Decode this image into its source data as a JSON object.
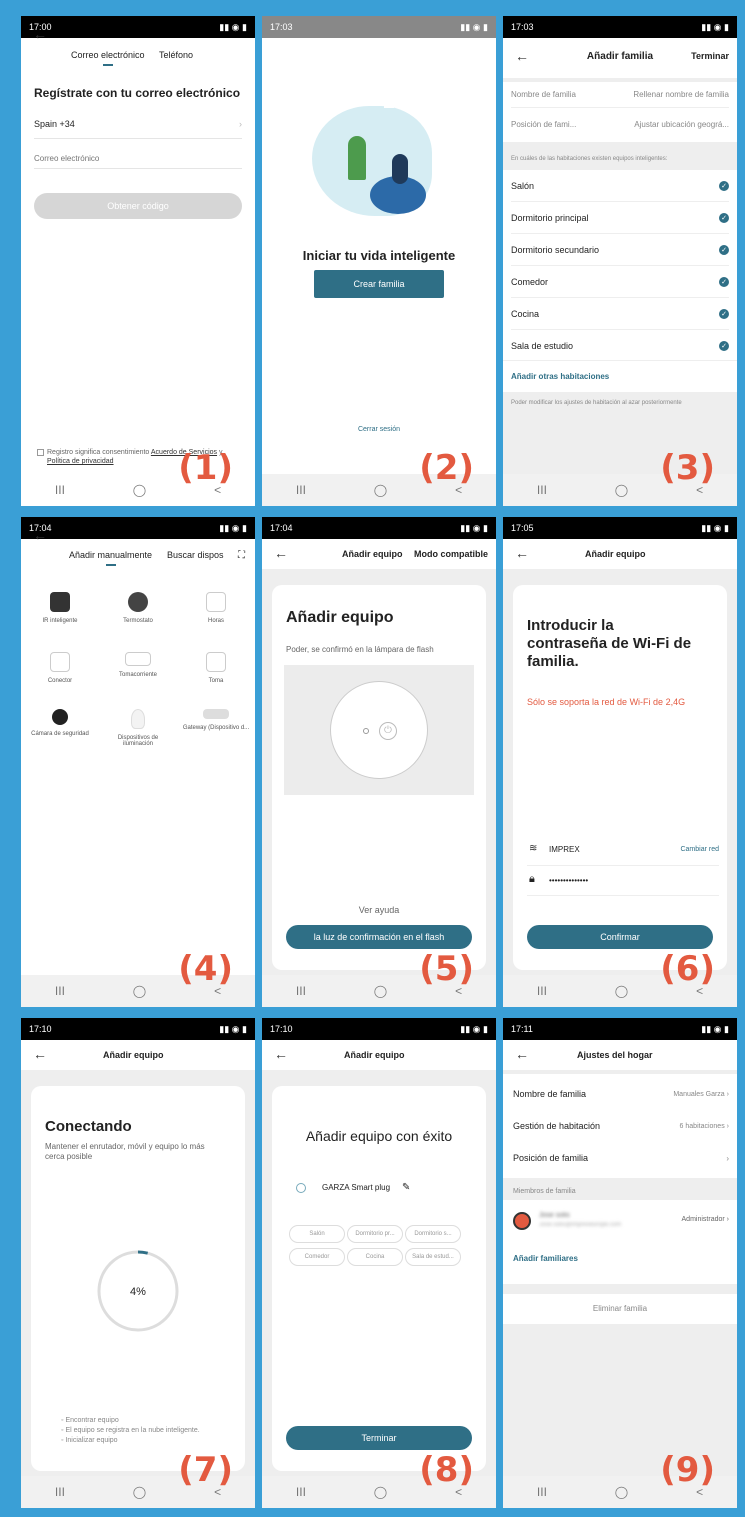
{
  "colors": {
    "accent": "#2f6f86",
    "badge": "#e35a40",
    "border": "#3a9fd6"
  },
  "badges": [
    "(1)",
    "(2)",
    "(3)",
    "(4)",
    "(5)",
    "(6)",
    "(7)",
    "(8)",
    "(9)"
  ],
  "nav": {
    "recent": "III",
    "home": "◯",
    "back": "<"
  },
  "s1": {
    "time": "17:00",
    "tab_email": "Correo electrónico",
    "tab_phone": "Teléfono",
    "heading": "Regístrate con tu correo electrónico",
    "country": "Spain +34",
    "email_placeholder": "Correo electrónico",
    "button": "Obtener código",
    "consent_prefix": "Registro significa consentimiento",
    "terms_link": "Acuerdo de Servicios",
    "and": "y",
    "privacy_link": "Política de privacidad"
  },
  "s2": {
    "time": "17:03",
    "heading": "Iniciar tu vida inteligente",
    "button": "Crear familia",
    "logout": "Cerrar sesión"
  },
  "s3": {
    "time": "17:03",
    "title": "Añadir familia",
    "done": "Terminar",
    "name_label": "Nombre de familia",
    "name_placeholder": "Rellenar nombre de familia",
    "pos_label": "Posición de fami...",
    "pos_placeholder": "Ajustar ubicación geográ...",
    "rooms_hint": "En cuáles de las habitaciones existen equipos inteligentes:",
    "rooms": [
      "Salón",
      "Dormitorio principal",
      "Dormitorio secundario",
      "Comedor",
      "Cocina",
      "Sala de estudio"
    ],
    "add_rooms": "Añadir otras habitaciones",
    "footnote": "Poder modificar los ajustes de habitación al azar posteriormente"
  },
  "s4": {
    "time": "17:04",
    "tab_manual": "Añadir manualmente",
    "tab_search": "Buscar dispos",
    "devices": [
      "IR inteligente",
      "Termostato",
      "Horas",
      "Conector",
      "Tomacorriente",
      "Toma",
      "Cámara de seguridad",
      "Dispositivos de iluminación",
      "Gateway (Dispositivo d..."
    ]
  },
  "s5": {
    "time": "17:04",
    "title": "Añadir equipo",
    "mode": "Modo compatible",
    "heading": "Añadir equipo",
    "desc": "Poder, se confirmó en la lámpara de flash",
    "help": "Ver ayuda",
    "button": "la luz de confirmación en el flash"
  },
  "s6": {
    "time": "17:05",
    "title": "Añadir equipo",
    "heading": "Introducir la contraseña de Wi-Fi de familia.",
    "warning": "Sólo se soporta la red de Wi-Fi de 2,4G",
    "ssid": "IMPREX",
    "change": "Cambiar red",
    "password": "••••••••••••••",
    "button": "Confirmar"
  },
  "s7": {
    "time": "17:10",
    "title": "Añadir equipo",
    "heading": "Conectando",
    "desc": "Mantener el enrutador, móvil y equipo lo más cerca posible",
    "progress": "4%",
    "progress_value": 4,
    "steps": [
      "Encontrar equipo",
      "El equipo se registra en la nube inteligente.",
      "Inicializar equipo"
    ]
  },
  "s8": {
    "time": "17:10",
    "title": "Añadir equipo",
    "heading": "Añadir equipo con éxito",
    "device": "GARZA Smart plug",
    "rooms": [
      "Salón",
      "Dormitorio pr...",
      "Dormitorio s...",
      "Comedor",
      "Cocina",
      "Sala de estud..."
    ],
    "button": "Terminar"
  },
  "s9": {
    "time": "17:11",
    "title": "Ajustes del hogar",
    "name_label": "Nombre de familia",
    "name_value": "Manuales Garza",
    "rooms_label": "Gestión de habitación",
    "rooms_value": "6 habitaciones",
    "pos_label": "Posición de familia",
    "members_header": "Miembros de familia",
    "member_name": "Jose solis",
    "member_email": "Jose.solis@imprexeurope.com",
    "member_role": "Administrador",
    "add_members": "Añadir familiares",
    "delete": "Eliminar familia"
  }
}
